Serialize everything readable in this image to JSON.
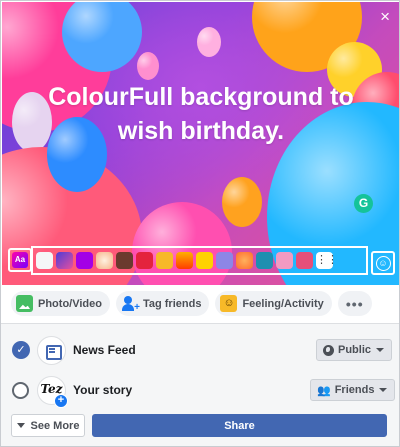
{
  "composer": {
    "text": "ColourFull background to wish birthday.",
    "close_icon": "×",
    "background_theme": "balloons",
    "accent_color": "#4267b2"
  },
  "swatches": {
    "text_toggle_label": "Aa",
    "items": [
      {
        "name": "white-swatch",
        "color": "#f5f6f7"
      },
      {
        "name": "gradient-blue-pink-swatch",
        "color": "#7a3ae0"
      },
      {
        "name": "purple-swatch",
        "color": "#a300e6"
      },
      {
        "name": "peach-swatch",
        "color": "#f6b48a"
      },
      {
        "name": "brown-swatch",
        "color": "#6b3a2e"
      },
      {
        "name": "red-heart-swatch",
        "color": "#e4233d"
      },
      {
        "name": "heart-eyes-swatch",
        "color": "#f7b928"
      },
      {
        "name": "fire-swatch",
        "color": "#ff6a00"
      },
      {
        "name": "yellow-swatch",
        "color": "#ffd200"
      },
      {
        "name": "lavender-swatch",
        "color": "#8d86e6"
      },
      {
        "name": "orange-swatch",
        "color": "#ff8c3b"
      },
      {
        "name": "teal-swatch",
        "color": "#1e8fb0"
      },
      {
        "name": "pink-swatch",
        "color": "#f29ac2"
      },
      {
        "name": "rose-swatch",
        "color": "#e54f7a"
      }
    ],
    "more_icon": "grid-icon"
  },
  "actions": {
    "photo_video": "Photo/Video",
    "tag_friends": "Tag friends",
    "feeling_activity": "Feeling/Activity",
    "more": "•••"
  },
  "audience": {
    "news_feed": {
      "label": "News Feed",
      "selected": true,
      "privacy": "Public"
    },
    "your_story": {
      "label": "Your story",
      "selected": false,
      "privacy": "Friends",
      "avatar_text": "Tez"
    }
  },
  "footer": {
    "see_more": "See More",
    "share": "Share"
  }
}
